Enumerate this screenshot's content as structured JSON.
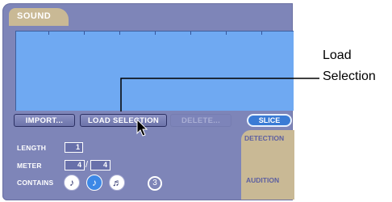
{
  "panel": {
    "title": "SOUND"
  },
  "buttons": {
    "import": "IMPORT...",
    "load_selection": "LOAD SELECTION",
    "delete": "DELETE...",
    "slice": "SLICE"
  },
  "side_tabs": {
    "detection": "DETECTION",
    "audition": "AUDITION"
  },
  "fields": {
    "length_label": "LENGTH",
    "length_value": "1",
    "meter_label": "METER",
    "meter_numerator": "4",
    "meter_slash": "/",
    "meter_denominator": "4",
    "contains_label": "CONTAINS",
    "contains_count": "3"
  },
  "notes": [
    {
      "icon": "eighth-note-icon",
      "glyph": "♪"
    },
    {
      "icon": "eighth-note-icon",
      "glyph": "♪"
    },
    {
      "icon": "sixteenth-note-icon",
      "glyph": "♬"
    }
  ],
  "callout": {
    "line1": "Load",
    "line2": "Selection"
  },
  "colors": {
    "panel": "#7e85b8",
    "waveform": "#6fa9f2",
    "tab": "#c9b995",
    "slice_button": "#3a7bd5"
  }
}
